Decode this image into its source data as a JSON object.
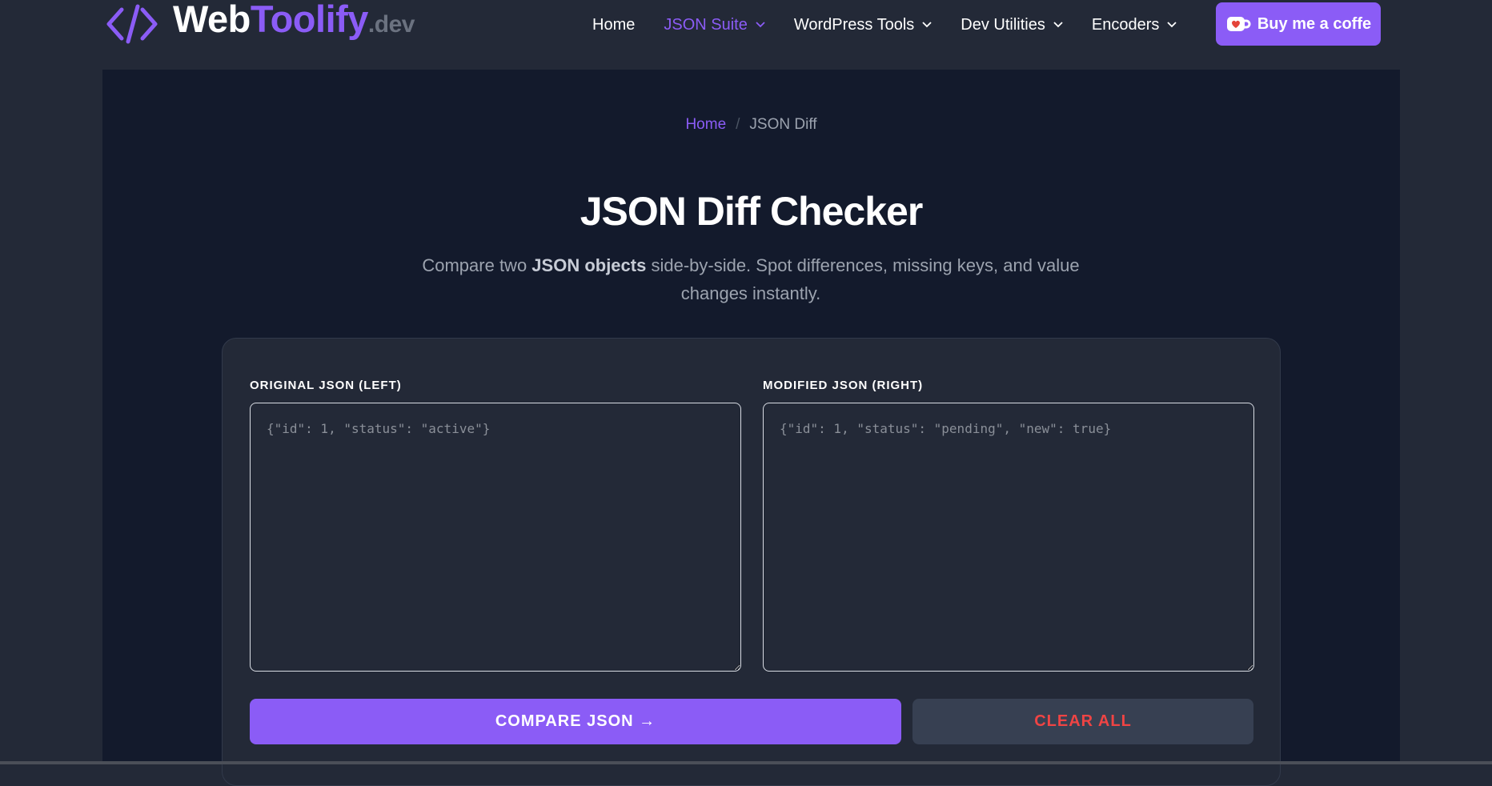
{
  "brand": {
    "name_part1": "Web",
    "name_part2": "Toolify",
    "name_suffix": ".dev"
  },
  "nav": {
    "items": [
      {
        "label": "Home",
        "dropdown": false
      },
      {
        "label": "JSON Suite",
        "dropdown": true,
        "active": true
      },
      {
        "label": "WordPress Tools",
        "dropdown": true
      },
      {
        "label": "Dev Utilities",
        "dropdown": true
      },
      {
        "label": "Encoders",
        "dropdown": true
      }
    ],
    "cta_label": "Buy me a coffe"
  },
  "breadcrumb": {
    "home": "Home",
    "separator": "/",
    "current": "JSON Diff"
  },
  "page": {
    "title": "JSON Diff Checker",
    "desc_before": "Compare two ",
    "desc_bold": "JSON objects",
    "desc_after": " side-by-side. Spot differences, missing keys, and value changes instantly."
  },
  "editor": {
    "left_label": "ORIGINAL JSON (LEFT)",
    "left_value": "",
    "left_placeholder": "{\"id\": 1, \"status\": \"active\"}",
    "right_label": "MODIFIED JSON (RIGHT)",
    "right_value": "",
    "right_placeholder": "{\"id\": 1, \"status\": \"pending\", \"new\": true}",
    "compare_label": "COMPARE JSON →",
    "clear_label": "CLEAR ALL"
  },
  "colors": {
    "accent": "#8b5cf6",
    "background": "#232937",
    "main_panel": "#131a2c",
    "danger": "#ef4444"
  },
  "icons": {
    "logo": "code-brackets-icon",
    "dropdown": "chevron-down-icon",
    "cta": "coffee-cup-icon"
  }
}
